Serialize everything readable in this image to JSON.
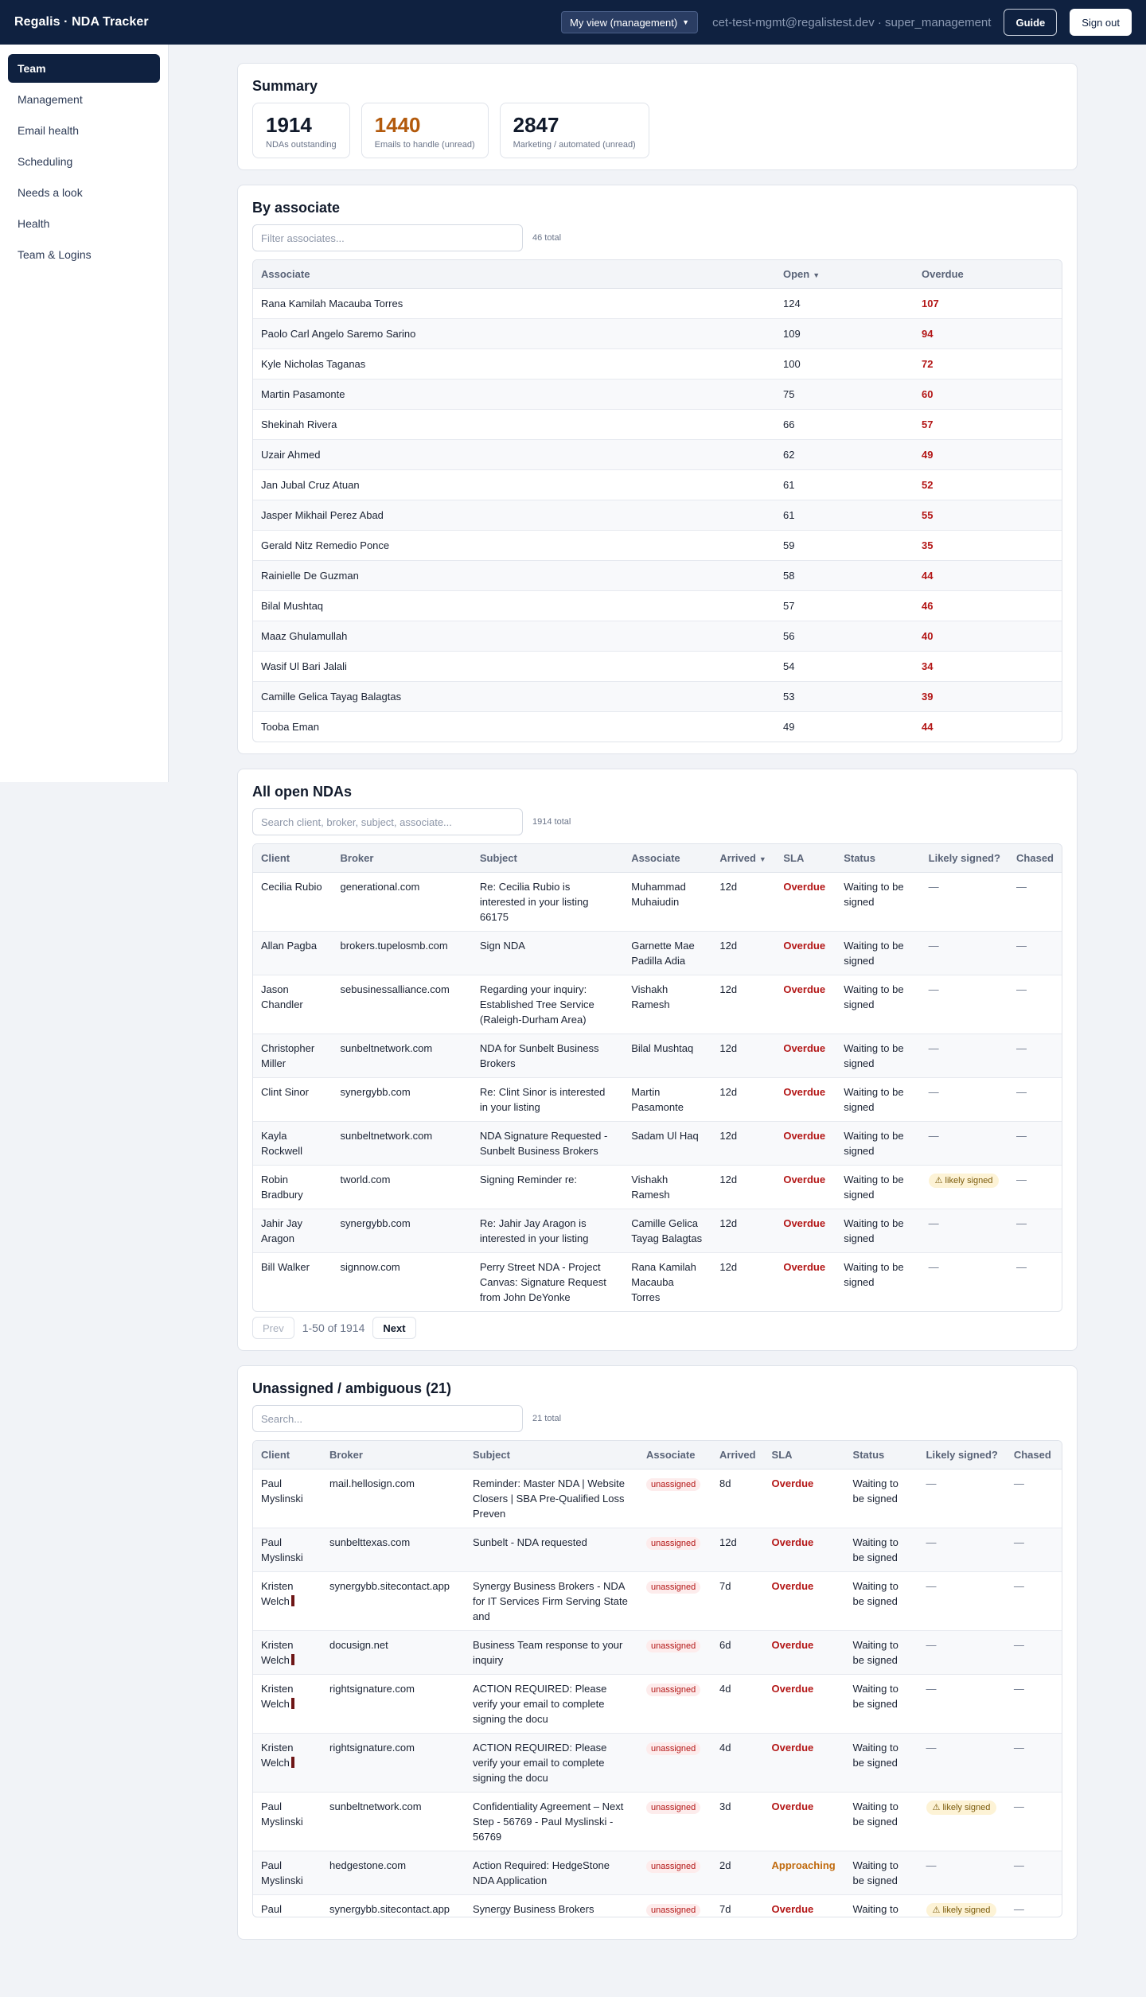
{
  "header": {
    "brand": "Regalis · NDA Tracker",
    "view_select": "My view (management)",
    "user": "cet-test-mgmt@regalistest.dev · super_management",
    "guide": "Guide",
    "signout": "Sign out"
  },
  "sidebar": {
    "items": [
      {
        "label": "Team",
        "active": true
      },
      {
        "label": "Management"
      },
      {
        "label": "Email health"
      },
      {
        "label": "Scheduling"
      },
      {
        "label": "Needs a look"
      },
      {
        "label": "Health"
      },
      {
        "label": "Team & Logins"
      }
    ]
  },
  "summary": {
    "title": "Summary",
    "stats": [
      {
        "value": "1914",
        "label": "NDAs outstanding"
      },
      {
        "value": "1440",
        "label": "Emails to handle (unread)"
      },
      {
        "value": "2847",
        "label": "Marketing / automated (unread)"
      }
    ]
  },
  "associates": {
    "title": "By associate",
    "filter_placeholder": "Filter associates...",
    "count": "46 total",
    "headers": [
      "Associate",
      "Open",
      "Overdue"
    ],
    "rows": [
      [
        "Rana Kamilah Macauba Torres",
        "124",
        "107"
      ],
      [
        "Paolo Carl Angelo Saremo Sarino",
        "109",
        "94"
      ],
      [
        "Kyle Nicholas Taganas",
        "100",
        "72"
      ],
      [
        "Martin Pasamonte",
        "75",
        "60"
      ],
      [
        "Shekinah Rivera",
        "66",
        "57"
      ],
      [
        "Uzair Ahmed",
        "62",
        "49"
      ],
      [
        "Jan Jubal Cruz Atuan",
        "61",
        "52"
      ],
      [
        "Jasper Mikhail Perez Abad",
        "61",
        "55"
      ],
      [
        "Gerald Nitz Remedio Ponce",
        "59",
        "35"
      ],
      [
        "Rainielle De Guzman",
        "58",
        "44"
      ],
      [
        "Bilal Mushtaq",
        "57",
        "46"
      ],
      [
        "Maaz Ghulamullah",
        "56",
        "40"
      ],
      [
        "Wasif Ul Bari Jalali",
        "54",
        "34"
      ],
      [
        "Camille Gelica Tayag Balagtas",
        "53",
        "39"
      ],
      [
        "Tooba Eman",
        "49",
        "44"
      ]
    ]
  },
  "open_ndas": {
    "title": "All open NDAs",
    "search_placeholder": "Search client, broker, subject, associate...",
    "count": "1914 total",
    "headers": [
      "Client",
      "Broker",
      "Subject",
      "Associate",
      "Arrived",
      "SLA",
      "Status",
      "Likely signed?",
      "Chased"
    ],
    "rows": [
      [
        "Cecilia Rubio",
        "generational.com",
        "Re: Cecilia Rubio is interested in your listing 66175",
        "Muhammad Muhaiudin",
        "12d",
        "Overdue",
        "Waiting to be signed",
        "—",
        "—"
      ],
      [
        "Allan Pagba",
        "brokers.tupelosmb.com",
        "Sign NDA",
        "Garnette Mae Padilla Adia",
        "12d",
        "Overdue",
        "Waiting to be signed",
        "—",
        "—"
      ],
      [
        "Jason Chandler",
        "sebusinessalliance.com",
        "Regarding your inquiry: Established Tree Service (Raleigh-Durham Area)",
        "Vishakh Ramesh",
        "12d",
        "Overdue",
        "Waiting to be signed",
        "—",
        "—"
      ],
      [
        "Christopher Miller",
        "sunbeltnetwork.com",
        "NDA for Sunbelt Business Brokers",
        "Bilal Mushtaq",
        "12d",
        "Overdue",
        "Waiting to be signed",
        "—",
        "—"
      ],
      [
        "Clint Sinor",
        "synergybb.com",
        "Re: Clint Sinor is interested in your listing",
        "Martin Pasamonte",
        "12d",
        "Overdue",
        "Waiting to be signed",
        "—",
        "—"
      ],
      [
        "Kayla Rockwell",
        "sunbeltnetwork.com",
        "NDA Signature Requested - Sunbelt Business Brokers",
        "Sadam Ul Haq",
        "12d",
        "Overdue",
        "Waiting to be signed",
        "—",
        "—"
      ],
      [
        "Robin Bradbury",
        "tworld.com",
        "Signing Reminder re:",
        "Vishakh Ramesh",
        "12d",
        "Overdue",
        "Waiting to be signed",
        "⚠ likely signed",
        "—"
      ],
      [
        "Jahir Jay Aragon",
        "synergybb.com",
        "Re: Jahir Jay Aragon is interested in your listing",
        "Camille Gelica Tayag Balagtas",
        "12d",
        "Overdue",
        "Waiting to be signed",
        "—",
        "—"
      ],
      [
        "Bill Walker",
        "signnow.com",
        "Perry Street NDA - Project Canvas: Signature Request from John DeYonke",
        "Rana Kamilah Macauba Torres",
        "12d",
        "Overdue",
        "Waiting to be signed",
        "—",
        "—"
      ]
    ],
    "pager": {
      "prev": "Prev",
      "info": "1-50 of 1914",
      "next": "Next"
    }
  },
  "unassigned": {
    "title": "Unassigned / ambiguous (21)",
    "search_placeholder": "Search...",
    "count": "21 total",
    "headers": [
      "Client",
      "Broker",
      "Subject",
      "Associate",
      "Arrived",
      "SLA",
      "Status",
      "Likely signed?",
      "Chased"
    ],
    "rows": [
      [
        "Paul Myslinski",
        "mail.hellosign.com",
        "Reminder: Master NDA | Website Closers | SBA Pre-Qualified Loss Preven",
        "unassigned",
        "8d",
        "Overdue",
        "Waiting to be signed",
        "—",
        "—"
      ],
      [
        "Paul Myslinski",
        "sunbelttexas.com",
        "Sunbelt - NDA requested",
        "unassigned",
        "12d",
        "Overdue",
        "Waiting to be signed",
        "—",
        "—"
      ],
      [
        "Kristen Welch",
        "synergybb.sitecontact.app",
        "Synergy Business Brokers - NDA for IT Services Firm Serving State and",
        "unassigned",
        "7d",
        "Overdue",
        "Waiting to be signed",
        "—",
        "—"
      ],
      [
        "Kristen Welch",
        "docusign.net",
        "Business Team response to your inquiry",
        "unassigned",
        "6d",
        "Overdue",
        "Waiting to be signed",
        "—",
        "—"
      ],
      [
        "Kristen Welch",
        "rightsignature.com",
        "ACTION REQUIRED: Please verify your email to complete signing the docu",
        "unassigned",
        "4d",
        "Overdue",
        "Waiting to be signed",
        "—",
        "—"
      ],
      [
        "Kristen Welch",
        "rightsignature.com",
        "ACTION REQUIRED: Please verify your email to complete signing the docu",
        "unassigned",
        "4d",
        "Overdue",
        "Waiting to be signed",
        "—",
        "—"
      ],
      [
        "Paul Myslinski",
        "sunbeltnetwork.com",
        "Confidentiality Agreement – Next Step - 56769 - Paul Myslinski - 56769",
        "unassigned",
        "3d",
        "Overdue",
        "Waiting to be signed",
        "⚠ likely signed",
        "—"
      ],
      [
        "Paul Myslinski",
        "hedgestone.com",
        "Action Required: HedgeStone NDA Application",
        "unassigned",
        "2d",
        "Approaching",
        "Waiting to be signed",
        "—",
        "—"
      ],
      [
        "Paul Myslinski",
        "synergybb.sitecontact.app",
        "Synergy Business Brokers",
        "unassigned",
        "7d",
        "Overdue",
        "Waiting to be signed",
        "⚠ likely signed",
        "—"
      ]
    ]
  }
}
